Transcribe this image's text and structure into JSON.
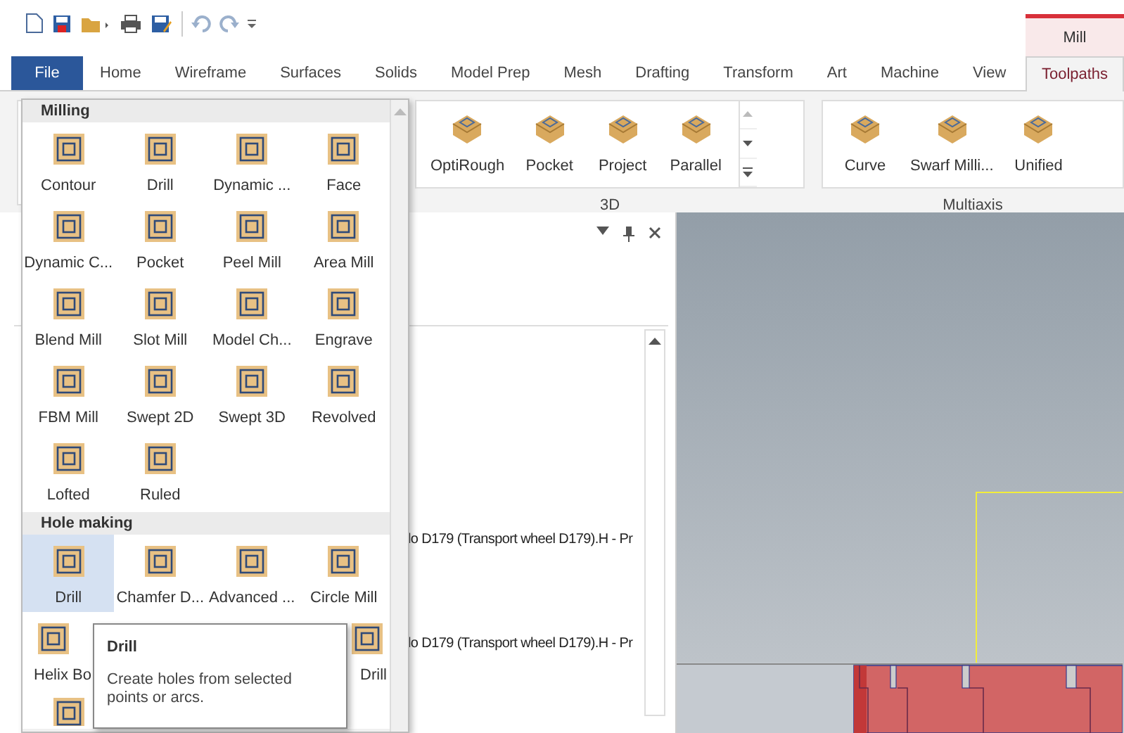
{
  "contextual_tab": {
    "label": "Mill"
  },
  "tabs": [
    {
      "label": "File",
      "kind": "file",
      "selected": false
    },
    {
      "label": "Home",
      "kind": "tab",
      "selected": false
    },
    {
      "label": "Wireframe",
      "kind": "tab",
      "selected": false
    },
    {
      "label": "Surfaces",
      "kind": "tab",
      "selected": false
    },
    {
      "label": "Solids",
      "kind": "tab",
      "selected": false
    },
    {
      "label": "Model Prep",
      "kind": "tab",
      "selected": false
    },
    {
      "label": "Mesh",
      "kind": "tab",
      "selected": false
    },
    {
      "label": "Drafting",
      "kind": "tab",
      "selected": false
    },
    {
      "label": "Transform",
      "kind": "tab",
      "selected": false
    },
    {
      "label": "Art",
      "kind": "tab",
      "selected": false
    },
    {
      "label": "Machine",
      "kind": "tab",
      "selected": false
    },
    {
      "label": "View",
      "kind": "tab",
      "selected": false
    },
    {
      "label": "Toolpaths",
      "kind": "tab",
      "selected": true
    }
  ],
  "ribbon": {
    "groups": [
      {
        "label": "3D",
        "items": [
          "OptiRough",
          "Pocket",
          "Project",
          "Parallel"
        ]
      },
      {
        "label": "Multiaxis",
        "items": [
          "Curve",
          "Swarf Milli...",
          "Unified"
        ]
      }
    ]
  },
  "panel": {
    "rows": [
      "lo D179 (Transport wheel D179).H - Pr",
      "lo D179 (Transport wheel D179).H - Pr"
    ]
  },
  "gallery": {
    "sections": [
      {
        "title": "Milling",
        "items": [
          {
            "kind": "tool",
            "label": "Contour",
            "selected": false
          },
          {
            "kind": "tool",
            "label": "Drill",
            "selected": false
          },
          {
            "kind": "tool",
            "label": "Dynamic ...",
            "selected": false
          },
          {
            "kind": "tool",
            "label": "Face",
            "selected": false
          },
          {
            "kind": "tool",
            "label": "Dynamic C...",
            "selected": false
          },
          {
            "kind": "tool",
            "label": "Pocket",
            "selected": false
          },
          {
            "kind": "tool",
            "label": "Peel Mill",
            "selected": false
          },
          {
            "kind": "tool",
            "label": "Area Mill",
            "selected": false
          },
          {
            "kind": "tool",
            "label": "Blend Mill",
            "selected": false
          },
          {
            "kind": "tool",
            "label": "Slot Mill",
            "selected": false
          },
          {
            "kind": "tool",
            "label": "Model Ch...",
            "selected": false
          },
          {
            "kind": "tool",
            "label": "Engrave",
            "selected": false
          },
          {
            "kind": "tool",
            "label": "FBM Mill",
            "selected": false
          },
          {
            "kind": "tool",
            "label": "Swept 2D",
            "selected": false
          },
          {
            "kind": "tool",
            "label": "Swept 3D",
            "selected": false
          },
          {
            "kind": "tool",
            "label": "Revolved",
            "selected": false
          },
          {
            "kind": "tool",
            "label": "Lofted",
            "selected": false
          },
          {
            "kind": "tool",
            "label": "Ruled",
            "selected": false
          }
        ]
      },
      {
        "title": "Hole making",
        "items": [
          {
            "kind": "tool",
            "label": "Drill",
            "selected": true
          },
          {
            "kind": "tool",
            "label": "Chamfer D...",
            "selected": false
          },
          {
            "kind": "tool",
            "label": "Advanced ...",
            "selected": false
          },
          {
            "kind": "tool",
            "label": "Circle Mill",
            "selected": false
          },
          {
            "kind": "tool",
            "label": "Helix Bo",
            "selected": false
          },
          {
            "kind": "covered"
          },
          {
            "kind": "covered"
          },
          {
            "kind": "tool",
            "label": "Drill",
            "selected": false
          },
          {
            "kind": "icon-only"
          }
        ]
      }
    ]
  },
  "tooltip": {
    "title": "Drill",
    "text": "Create holes from selected points or arcs."
  }
}
